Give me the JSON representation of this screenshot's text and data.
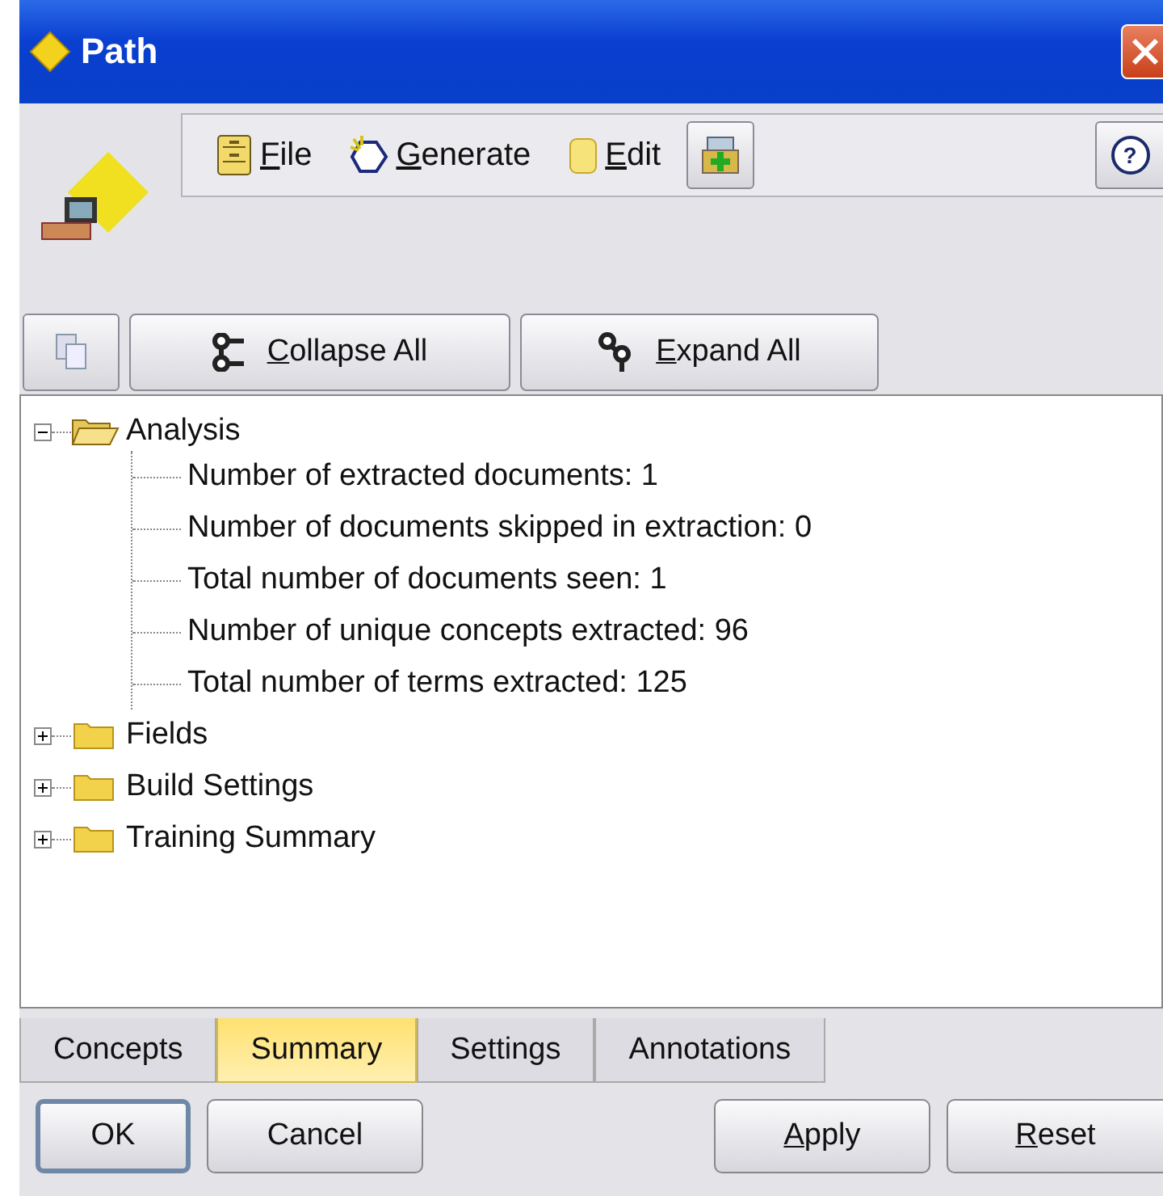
{
  "window": {
    "title": "Path"
  },
  "menu": [
    {
      "label": "File",
      "mnemonic": true,
      "kind": "file"
    },
    {
      "label": "Generate",
      "mnemonic": true,
      "kind": "generate"
    },
    {
      "label": "Edit",
      "mnemonic": true,
      "kind": "edit"
    }
  ],
  "help": {
    "label": "?"
  },
  "tree_toolbar": [
    {
      "label": "Collapse All",
      "mnemonic": true,
      "kind": "collapse"
    },
    {
      "label": "Expand All",
      "mnemonic": true,
      "kind": "expand"
    }
  ],
  "tree": [
    {
      "label": "Analysis",
      "expanded": true,
      "children": [
        {
          "label": "Number of extracted documents: 1"
        },
        {
          "label": "Number of documents skipped in extraction: 0"
        },
        {
          "label": "Total number of documents seen: 1"
        },
        {
          "label": "Number of unique concepts extracted: 96"
        },
        {
          "label": "Total number of terms extracted: 125"
        }
      ]
    },
    {
      "label": "Fields",
      "expanded": false
    },
    {
      "label": "Build Settings",
      "expanded": false
    },
    {
      "label": "Training Summary",
      "expanded": false
    }
  ],
  "tabs": [
    {
      "label": "Concepts",
      "selected": false
    },
    {
      "label": "Summary",
      "selected": true
    },
    {
      "label": "Settings",
      "selected": false
    },
    {
      "label": "Annotations",
      "selected": false
    }
  ],
  "buttons_left": [
    {
      "label": "OK",
      "mnemonic": false,
      "default": true
    },
    {
      "label": "Cancel",
      "mnemonic": false,
      "default": false
    }
  ],
  "buttons_right": [
    {
      "label": "Apply",
      "mnemonic": true,
      "default": false
    },
    {
      "label": "Reset",
      "mnemonic": true,
      "default": false
    }
  ]
}
